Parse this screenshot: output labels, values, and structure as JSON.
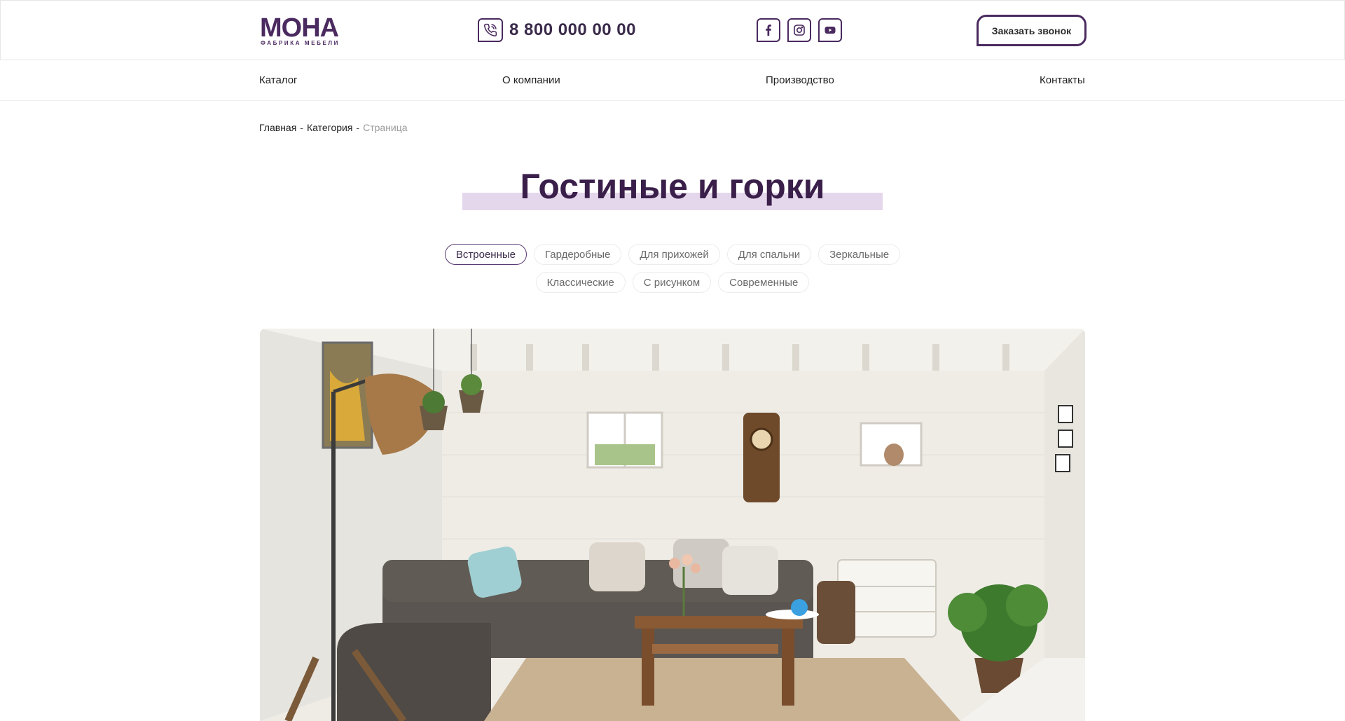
{
  "header": {
    "logo": {
      "word": "МОНА",
      "subtitle": "ФАБРИКА МЕБЕЛИ"
    },
    "phone": "8 800 000 00 00",
    "social": [
      "facebook-icon",
      "instagram-icon",
      "youtube-icon"
    ],
    "call_button": "Заказать звонок"
  },
  "nav": {
    "items": [
      {
        "label": "Каталог"
      },
      {
        "label": "О компании"
      },
      {
        "label": "Производство"
      },
      {
        "label": "Контакты"
      }
    ]
  },
  "breadcrumb": {
    "items": [
      "Главная",
      "Категория"
    ],
    "separator": "-",
    "current": "Страница"
  },
  "page": {
    "title": "Гостиные и горки"
  },
  "filters": {
    "row1": [
      "Встроенные",
      "Гардеробные",
      "Для прихожей",
      "Для спальни",
      "Зеркальные"
    ],
    "row2": [
      "Классические",
      "С рисунком",
      "Современные"
    ],
    "active": "Встроенные"
  },
  "colors": {
    "brand": "#4a2a5f",
    "title": "#3a1f4a",
    "highlight": "#e4d7ec"
  }
}
